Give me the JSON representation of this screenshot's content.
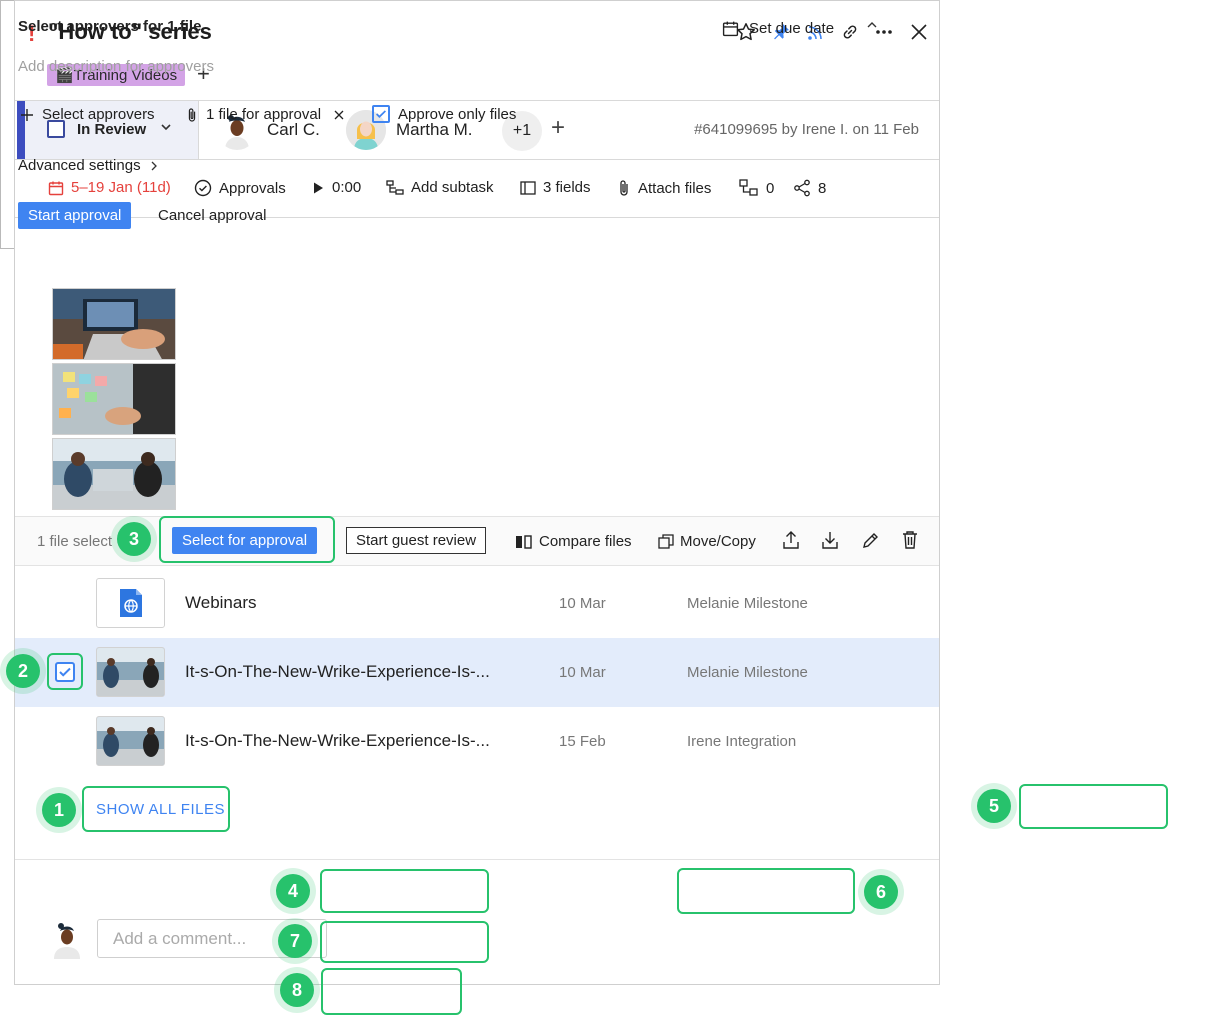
{
  "task": {
    "title": "\"How to\" series",
    "priority_mark": "!",
    "tag": "🎬Training Videos",
    "tag_add": "+",
    "status": "In Review",
    "assignees": [
      {
        "name": "Carl C."
      },
      {
        "name": "Martha M."
      }
    ],
    "more_assignees": "+1",
    "add_assignee": "+",
    "id_text": "#641099695 by Irene I. on 11 Feb"
  },
  "meta": {
    "dates": "5–19 Jan (11d)",
    "approvals": "Approvals",
    "timer": "0:00",
    "add_subtask": "Add subtask",
    "fields": "3 fields",
    "attach": "Attach files",
    "dependencies": "0",
    "shares": "8"
  },
  "toolbar": {
    "selected_text": "1 file select",
    "select_for_approval": "Select for approval",
    "start_guest_review": "Start guest review",
    "compare_files": "Compare files",
    "move_copy": "Move/Copy"
  },
  "files": [
    {
      "name": "Webinars",
      "date": "10 Mar",
      "owner": "Melanie Milestone"
    },
    {
      "name": "It-s-On-The-New-Wrike-Experience-Is-...",
      "date": "10 Mar",
      "owner": "Melanie Milestone"
    },
    {
      "name": "It-s-On-The-New-Wrike-Experience-Is-...",
      "date": "15 Feb",
      "owner": "Irene Integration"
    }
  ],
  "show_all_files": "SHOW ALL FILES",
  "comment_placeholder": "Add a comment...",
  "approval_popover": {
    "title": "Select approvers for 1 file",
    "description_placeholder": "Add description for approvers",
    "set_due_date": "Set due date",
    "select_approvers": "Select approvers",
    "file_count": "1 file for approval",
    "approve_only_files": "Approve only files",
    "advanced_settings": "Advanced settings",
    "start_approval": "Start approval",
    "cancel_approval": "Cancel approval"
  },
  "badges": [
    "1",
    "2",
    "3",
    "4",
    "5",
    "6",
    "7",
    "8"
  ],
  "colors": {
    "accent": "#3f84f1",
    "highlight": "#27c26c",
    "status": "#3d4dbf",
    "tag": "#d3a3e6",
    "date_red": "#e5413c"
  }
}
